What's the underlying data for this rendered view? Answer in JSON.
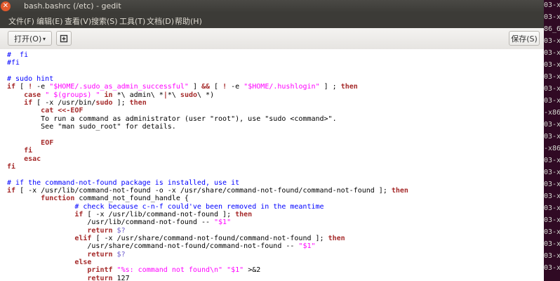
{
  "colors": {
    "comment": "#0000ff",
    "keyword": "#a52a2a",
    "string": "#ff00ff",
    "variable": "#6a5acd",
    "text": "#000000",
    "menubar": "#3c3b37",
    "close_button": "#e25a2c"
  },
  "window": {
    "title": "bash.bashrc (/etc) - gedit",
    "close_icon": "close-icon"
  },
  "menu": [
    "文件(F)",
    "编辑(E)",
    "查看(V)",
    "搜索(S)",
    "工具(T)",
    "文档(D)",
    "帮助(H)"
  ],
  "toolbar": {
    "open_label": "打开(O)",
    "open_caret": "▾",
    "new_document_icon": "new-document-icon",
    "save_label": "保存(S)"
  },
  "background_terminal": {
    "left_fragments": [
      "6:",
      "6:",
      "6:",
      "6:",
      "6:",
      "6:",
      "6:",
      "6:",
      "6:",
      "6:",
      "6:",
      "6:",
      "6:",
      "6:",
      "6:",
      "6:"
    ],
    "right_fragments": [
      "03-x",
      "03-x",
      "86_6",
      "03-x",
      "03-x",
      "03-x",
      "03-x",
      "03-x",
      "03-x",
      "-x86",
      "03-x",
      "03-x",
      "-x86",
      "03-x",
      "03-x",
      "03-x",
      "03-x",
      "03-x",
      "03-x",
      "03-x",
      "03-x",
      "03-x",
      "03-x"
    ]
  },
  "code_lines": [
    [
      {
        "t": "cmt",
        "s": "#  fi"
      }
    ],
    [
      {
        "t": "cmt",
        "s": "#fi"
      }
    ],
    [],
    [
      {
        "t": "cmt",
        "s": "# sudo hint"
      }
    ],
    [
      {
        "t": "kw",
        "s": "if"
      },
      {
        "t": "txt",
        "s": " [ "
      },
      {
        "t": "kw",
        "s": "!"
      },
      {
        "t": "txt",
        "s": " -e "
      },
      {
        "t": "str",
        "s": "\"$HOME/.sudo_as_admin_successful\""
      },
      {
        "t": "txt",
        "s": " ] "
      },
      {
        "t": "kw",
        "s": "&&"
      },
      {
        "t": "txt",
        "s": " [ "
      },
      {
        "t": "kw",
        "s": "!"
      },
      {
        "t": "txt",
        "s": " -e "
      },
      {
        "t": "str",
        "s": "\"$HOME/.hushlogin\""
      },
      {
        "t": "txt",
        "s": " ] ; "
      },
      {
        "t": "kw",
        "s": "then"
      }
    ],
    [
      {
        "t": "txt",
        "s": "    "
      },
      {
        "t": "kw",
        "s": "case"
      },
      {
        "t": "txt",
        "s": " "
      },
      {
        "t": "str",
        "s": "\" $(groups) \""
      },
      {
        "t": "txt",
        "s": " "
      },
      {
        "t": "kw",
        "s": "in"
      },
      {
        "t": "txt",
        "s": " *\\ admin\\ *"
      },
      {
        "t": "kw",
        "s": "|"
      },
      {
        "t": "txt",
        "s": "*\\ "
      },
      {
        "t": "kw",
        "s": "sudo"
      },
      {
        "t": "txt",
        "s": "\\ *)"
      }
    ],
    [
      {
        "t": "txt",
        "s": "    "
      },
      {
        "t": "kw",
        "s": "if"
      },
      {
        "t": "txt",
        "s": " [ -x /usr/bin/"
      },
      {
        "t": "kw",
        "s": "sudo"
      },
      {
        "t": "txt",
        "s": " ]; "
      },
      {
        "t": "kw",
        "s": "then"
      }
    ],
    [
      {
        "t": "txt",
        "s": "        "
      },
      {
        "t": "kw",
        "s": "cat"
      },
      {
        "t": "txt",
        "s": " "
      },
      {
        "t": "kw",
        "s": "<<-EOF"
      }
    ],
    [
      {
        "t": "txt",
        "s": "        To run a command as administrator (user \"root\"), use \"sudo <command>\"."
      }
    ],
    [
      {
        "t": "txt",
        "s": "        See \"man sudo_root\" for details."
      }
    ],
    [],
    [
      {
        "t": "txt",
        "s": "        "
      },
      {
        "t": "kw",
        "s": "EOF"
      }
    ],
    [
      {
        "t": "txt",
        "s": "    "
      },
      {
        "t": "kw",
        "s": "fi"
      }
    ],
    [
      {
        "t": "txt",
        "s": "    "
      },
      {
        "t": "kw",
        "s": "esac"
      }
    ],
    [
      {
        "t": "kw",
        "s": "fi"
      }
    ],
    [],
    [
      {
        "t": "cmt",
        "s": "# if the command-not-found package is installed, use it"
      }
    ],
    [
      {
        "t": "kw",
        "s": "if"
      },
      {
        "t": "txt",
        "s": " [ -x /usr/lib/command-not-found -o -x /usr/share/command-not-found/command-not-found ]; "
      },
      {
        "t": "kw",
        "s": "then"
      }
    ],
    [
      {
        "t": "txt",
        "s": "        "
      },
      {
        "t": "kw",
        "s": "function"
      },
      {
        "t": "txt",
        "s": " command_not_found_handle {"
      }
    ],
    [
      {
        "t": "txt",
        "s": "                "
      },
      {
        "t": "cmt",
        "s": "# check because c-n-f could've been removed in the meantime"
      }
    ],
    [
      {
        "t": "txt",
        "s": "                "
      },
      {
        "t": "kw",
        "s": "if"
      },
      {
        "t": "txt",
        "s": " [ -x /usr/lib/command-not-found ]; "
      },
      {
        "t": "kw",
        "s": "then"
      }
    ],
    [
      {
        "t": "txt",
        "s": "                   /usr/lib/command-not-found -- "
      },
      {
        "t": "str",
        "s": "\"$1\""
      }
    ],
    [
      {
        "t": "txt",
        "s": "                   "
      },
      {
        "t": "kw",
        "s": "return"
      },
      {
        "t": "txt",
        "s": " "
      },
      {
        "t": "var",
        "s": "$?"
      }
    ],
    [
      {
        "t": "txt",
        "s": "                "
      },
      {
        "t": "kw",
        "s": "elif"
      },
      {
        "t": "txt",
        "s": " [ -x /usr/share/command-not-found/command-not-found ]; "
      },
      {
        "t": "kw",
        "s": "then"
      }
    ],
    [
      {
        "t": "txt",
        "s": "                   /usr/share/command-not-found/command-not-found -- "
      },
      {
        "t": "str",
        "s": "\"$1\""
      }
    ],
    [
      {
        "t": "txt",
        "s": "                   "
      },
      {
        "t": "kw",
        "s": "return"
      },
      {
        "t": "txt",
        "s": " "
      },
      {
        "t": "var",
        "s": "$?"
      }
    ],
    [
      {
        "t": "txt",
        "s": "                "
      },
      {
        "t": "kw",
        "s": "else"
      }
    ],
    [
      {
        "t": "txt",
        "s": "                   "
      },
      {
        "t": "kw",
        "s": "printf"
      },
      {
        "t": "txt",
        "s": " "
      },
      {
        "t": "str",
        "s": "\"%s: command not found\\n\""
      },
      {
        "t": "txt",
        "s": " "
      },
      {
        "t": "str",
        "s": "\"$1\""
      },
      {
        "t": "txt",
        "s": " >&2"
      }
    ],
    [
      {
        "t": "txt",
        "s": "                   "
      },
      {
        "t": "kw",
        "s": "return"
      },
      {
        "t": "txt",
        "s": " 127"
      }
    ]
  ]
}
